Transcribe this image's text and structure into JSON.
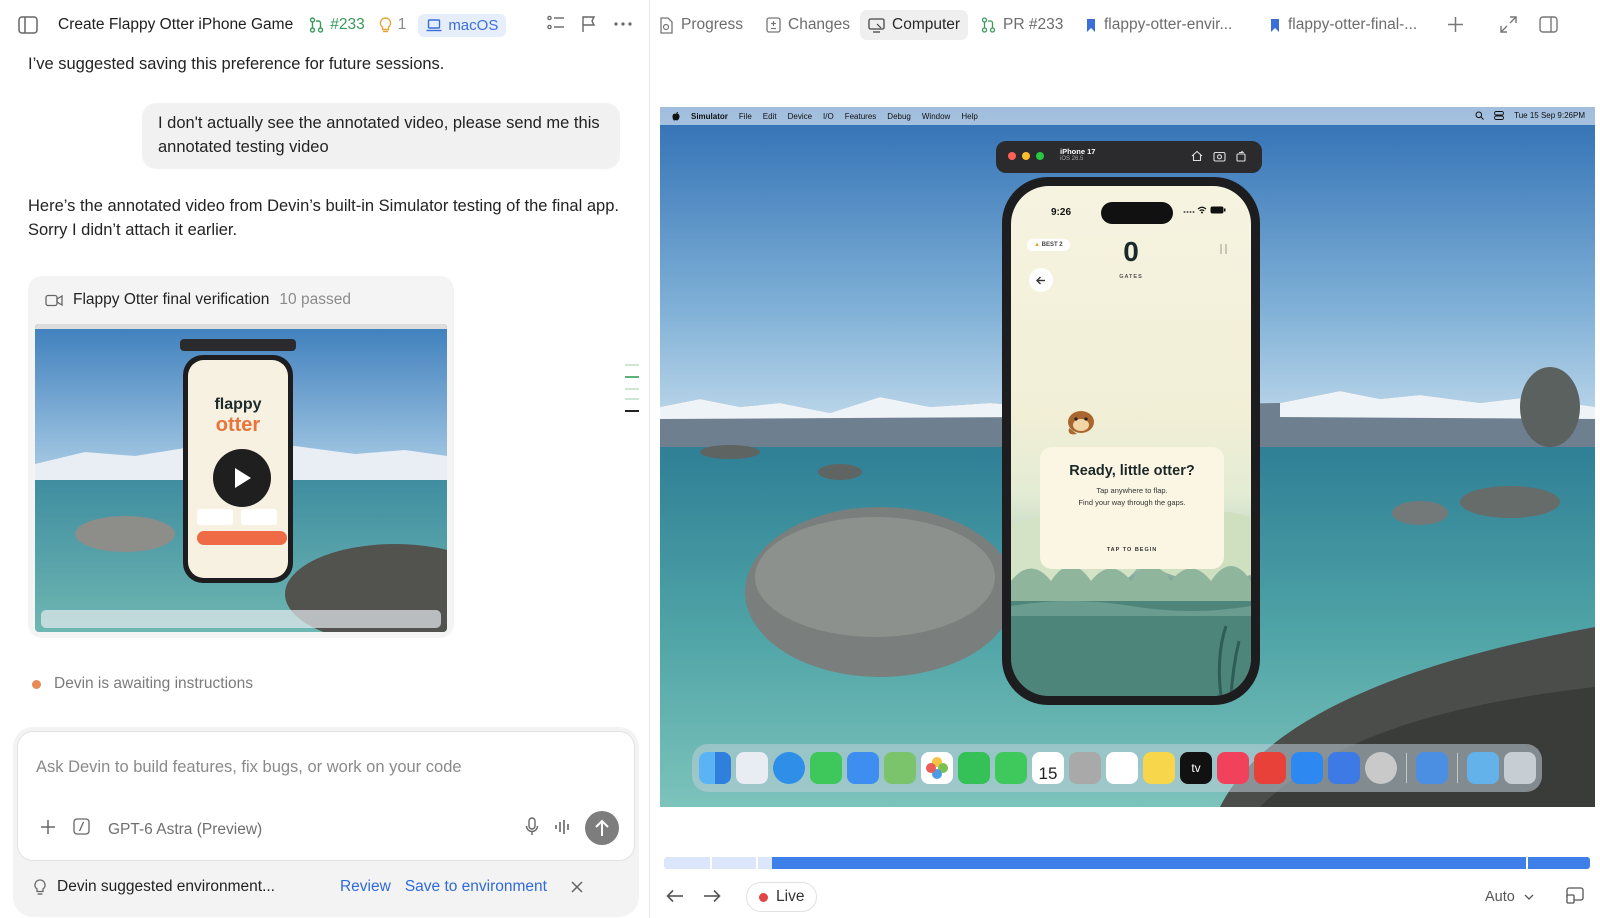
{
  "left_header": {
    "title": "Create Flappy Otter iPhone Game",
    "pr_number": "#233",
    "idea_count": "1",
    "platform": "macOS"
  },
  "chat": {
    "msg1": "I’ve suggested saving this preference for future sessions.",
    "user_msg": "I don't actually see the annotated video, please send me this annotated testing video",
    "msg2": "Here’s the annotated video from Devin’s built-in Simulator testing of the final app. Sorry I didn’t attach it earlier."
  },
  "video_card": {
    "title": "Flappy Otter final verification",
    "count": "10 passed"
  },
  "status": "Devin is awaiting instructions",
  "composer": {
    "placeholder": "Ask Devin to build features, fix bugs, or work on your code",
    "model": "GPT-6 Astra (Preview)"
  },
  "suggestion": {
    "text": "Devin suggested environment...",
    "review": "Review",
    "save": "Save to environment"
  },
  "right_tabs": [
    "Progress",
    "Changes",
    "Computer",
    "PR #233",
    "flappy-otter-envir...",
    "flappy-otter-final-..."
  ],
  "mac_menubar": {
    "app": "Simulator",
    "items": [
      "File",
      "Edit",
      "Device",
      "I/O",
      "Features",
      "Debug",
      "Window",
      "Help"
    ],
    "clock": "Tue 15 Sep  9:26PM"
  },
  "simulator": {
    "device": "iPhone 17",
    "os": "iOS 26.5"
  },
  "game": {
    "time": "9:26",
    "best": "BEST 2",
    "score": "0",
    "gates_label": "GATES",
    "heading": "Ready, little otter?",
    "sub1": "Tap anywhere to flap.",
    "sub2": "Find your way through the gaps.",
    "cta": "TAP TO BEGIN"
  },
  "dock": {
    "calendar_day": "15",
    "tv": "tv"
  },
  "playback": {
    "live": "Live",
    "quality": "Auto",
    "progress_start": 0.117,
    "progress_end": 1.0
  }
}
